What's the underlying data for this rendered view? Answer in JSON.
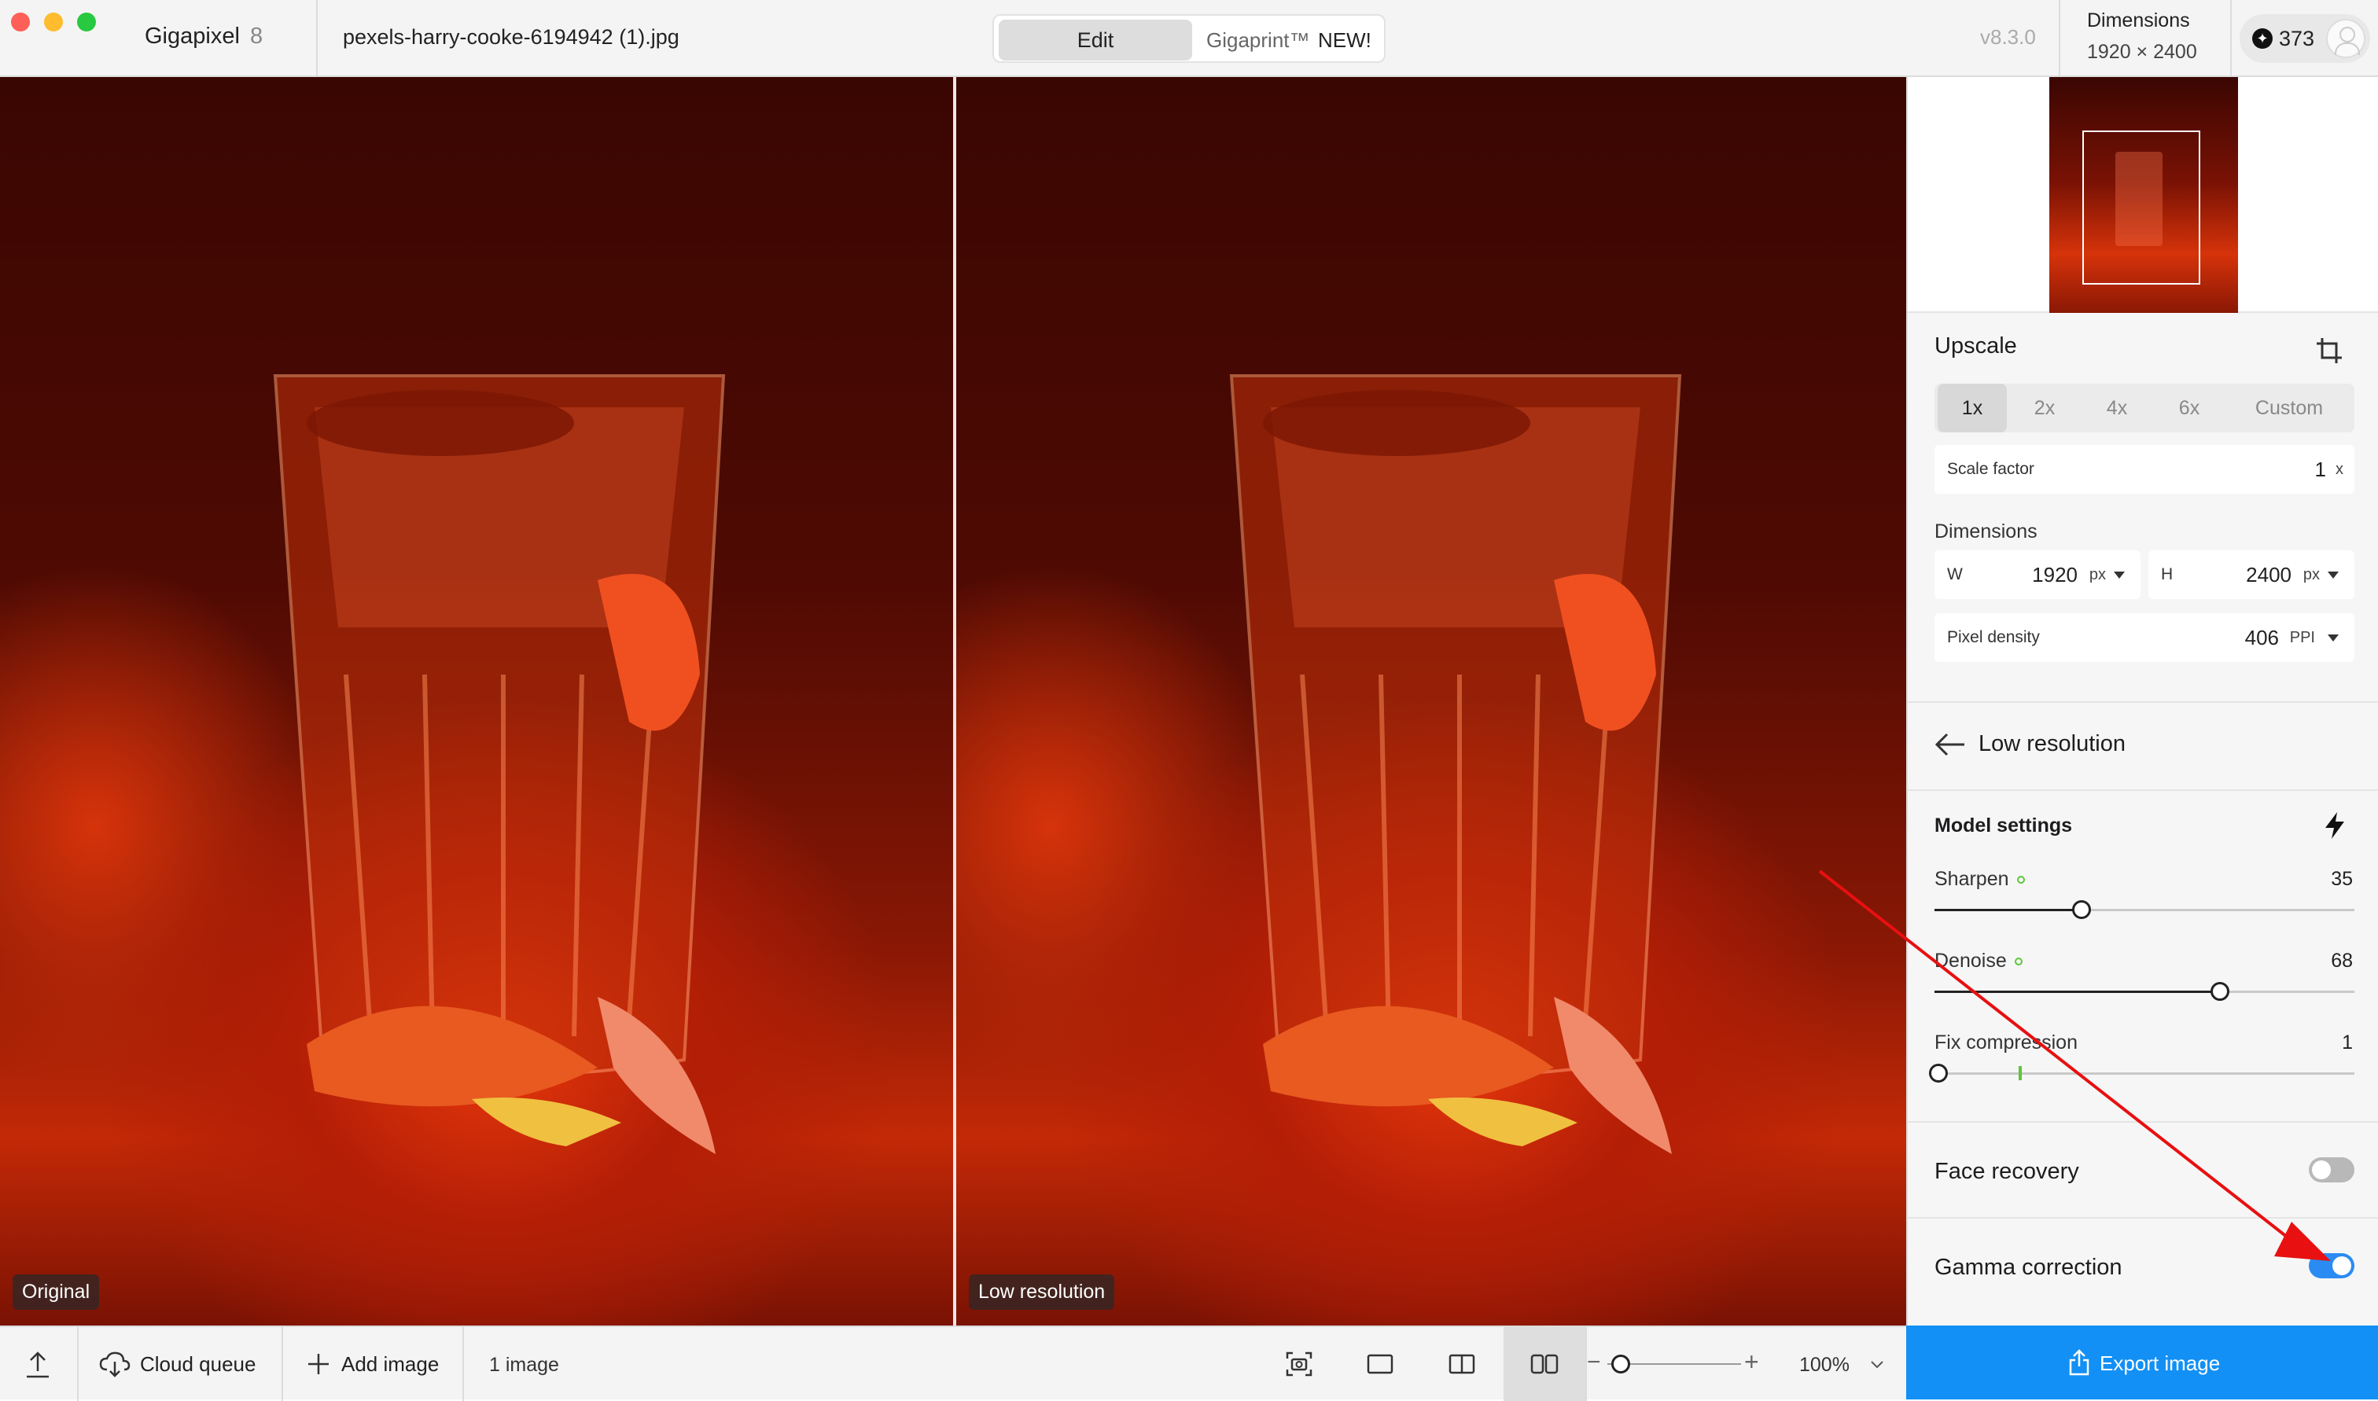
{
  "app": {
    "name": "Gigapixel",
    "version_badge": "8",
    "build": "v8.3.0"
  },
  "file": {
    "name": "pexels-harry-cooke-6194942 (1).jpg"
  },
  "mode_tabs": {
    "edit": "Edit",
    "print": "Gigaprint™",
    "print_badge": "NEW!"
  },
  "dimensions_header": {
    "label": "Dimensions",
    "value": "1920 × 2400"
  },
  "credits": {
    "count": "373"
  },
  "viewer": {
    "left_label": "Original",
    "right_label": "Low resolution"
  },
  "upscale": {
    "title": "Upscale",
    "scale_options": [
      "1x",
      "2x",
      "4x",
      "6x",
      "Custom"
    ],
    "selected_scale": "1x",
    "scale_factor_label": "Scale factor",
    "scale_factor_value": "1",
    "scale_factor_unit": "x",
    "dimensions_label": "Dimensions",
    "width_label": "W",
    "width_value": "1920",
    "width_unit": "px",
    "height_label": "H",
    "height_value": "2400",
    "height_unit": "px",
    "density_label": "Pixel density",
    "density_value": "406",
    "density_unit": "PPI"
  },
  "model": {
    "name": "Low resolution"
  },
  "model_settings": {
    "title": "Model settings",
    "sliders": [
      {
        "label": "Sharpen",
        "value": "35",
        "fraction": 0.35,
        "modified": true
      },
      {
        "label": "Denoise",
        "value": "68",
        "fraction": 0.68,
        "modified": true
      },
      {
        "label": "Fix compression",
        "value": "1",
        "fraction": 0.01,
        "default_fraction": 0.2,
        "modified": false
      }
    ]
  },
  "toggles": {
    "face_recovery": {
      "label": "Face recovery",
      "on": false
    },
    "gamma_correction": {
      "label": "Gamma correction",
      "on": true
    }
  },
  "bottombar": {
    "cloud_label": "Cloud queue",
    "add_label": "Add image",
    "count_label": "1 image",
    "zoom_value": "100%",
    "zoom_fraction": 0.1
  },
  "export": {
    "label": "Export image"
  },
  "colors": {
    "accent": "#1290f5",
    "toggle_on": "#2a8cf2",
    "annotation": "#e81010",
    "modified_dot": "#5cc73a"
  }
}
